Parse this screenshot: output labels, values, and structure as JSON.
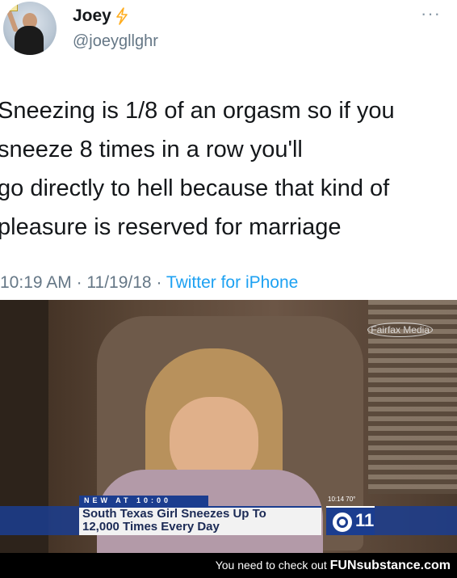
{
  "tweet": {
    "display_name": "Joey",
    "handle": "@joeygllghr",
    "text_lines": [
      "Sneezing is 1/8 of an orgasm so if you",
      "sneeze 8 times in a row you'll",
      "go directly to hell because that kind of",
      "pleasure is reserved for marriage"
    ],
    "time": "10:19 AM",
    "separator": "·",
    "date": "11/19/18",
    "source": "Twitter for iPhone"
  },
  "media": {
    "watermark": "Fairfax Media",
    "news_tag": "NEW AT 10:00",
    "headline_line1": "South Texas Girl Sneezes Up To",
    "headline_line2": "12,000 Times Every Day",
    "time_badge": "10:14  70°",
    "station_number": "11"
  },
  "footer": {
    "promo_text": "You need to check out",
    "brand": "FUNsubstance.com"
  },
  "colors": {
    "link_blue": "#1da1f2",
    "secondary_gray": "#657786",
    "news_blue": "#1b3d8f",
    "verified_bolt": "#ffad1f"
  },
  "icons": {
    "bolt": "lightning-bolt-icon",
    "more": "more-options-icon"
  }
}
